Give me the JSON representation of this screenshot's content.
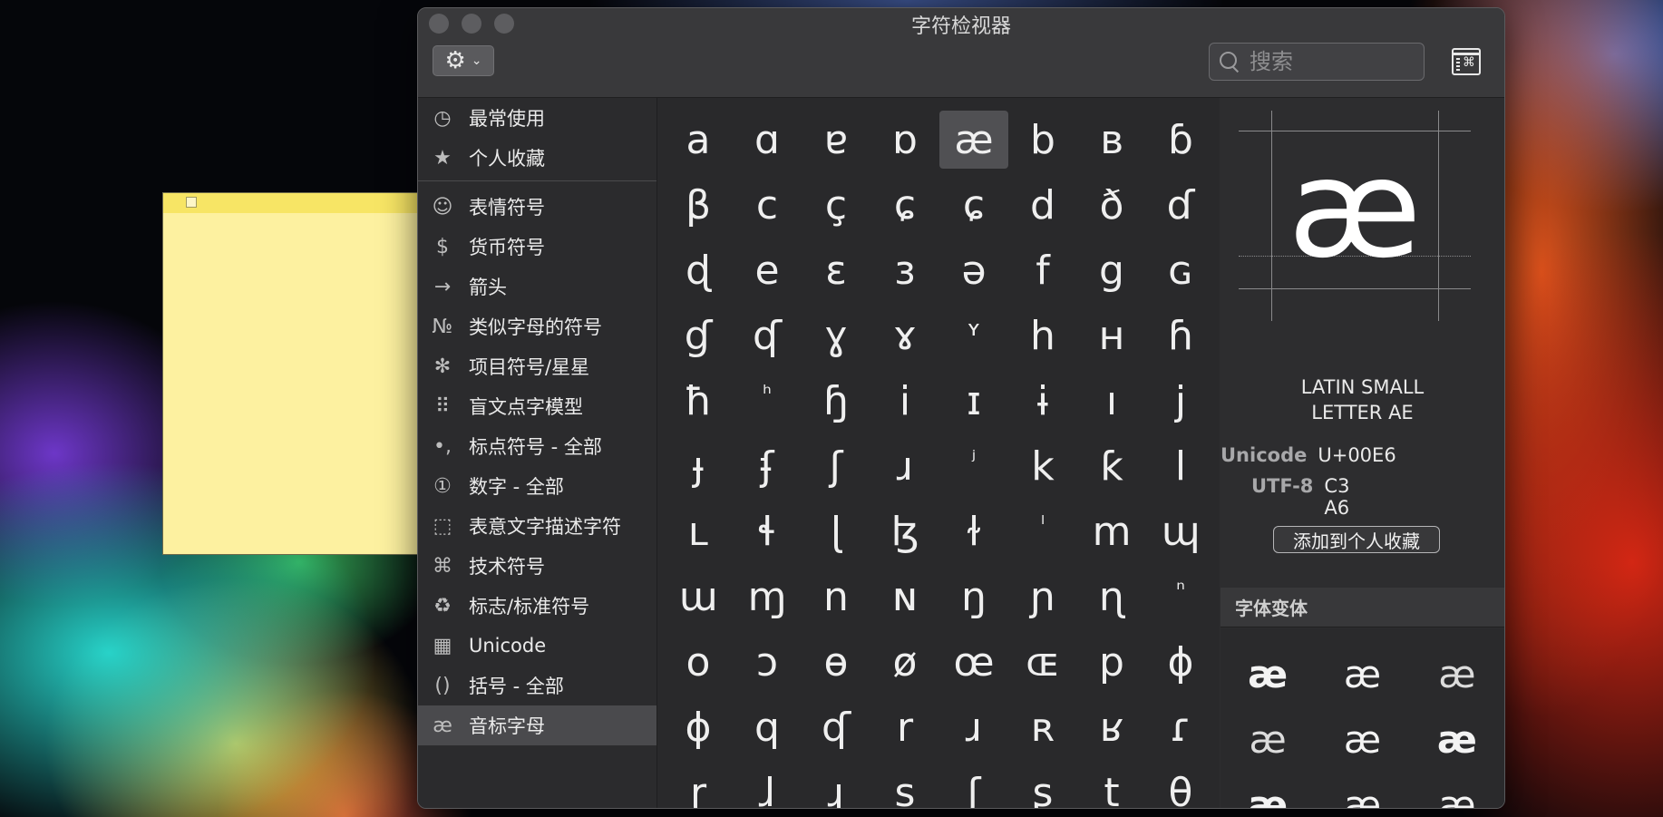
{
  "window": {
    "title": "字符检视器"
  },
  "toolbar": {
    "search_placeholder": "搜索"
  },
  "sidebar": {
    "items": [
      {
        "icon": "◷",
        "label": "最常使用"
      },
      {
        "icon": "★",
        "label": "个人收藏"
      },
      {
        "icon": "☺",
        "label": "表情符号"
      },
      {
        "icon": "$",
        "label": "货币符号"
      },
      {
        "icon": "→",
        "label": "箭头"
      },
      {
        "icon": "№",
        "label": "类似字母的符号"
      },
      {
        "icon": "✻",
        "label": "项目符号/星星"
      },
      {
        "icon": "⠿",
        "label": "盲文点字模型"
      },
      {
        "icon": "•,",
        "label": "标点符号 - 全部"
      },
      {
        "icon": "①",
        "label": "数字 - 全部"
      },
      {
        "icon": "⬚",
        "label": "表意文字描述字符"
      },
      {
        "icon": "⌘",
        "label": "技术符号"
      },
      {
        "icon": "♻",
        "label": "标志/标准符号"
      },
      {
        "icon": "▦",
        "label": "Unicode"
      },
      {
        "icon": "()",
        "label": "括号 - 全部"
      },
      {
        "icon": "æ",
        "label": "音标字母"
      }
    ]
  },
  "grid": {
    "rows": [
      [
        "a",
        "ɑ",
        "ɐ",
        "ɒ",
        "æ",
        "b",
        "ʙ",
        "ɓ"
      ],
      [
        "β",
        "c",
        "ç",
        "ɕ",
        "ɕ",
        "d",
        "ð",
        "ɗ"
      ],
      [
        "ɖ",
        "e",
        "ɛ",
        "ɜ",
        "ə",
        "f",
        "g",
        "ɢ"
      ],
      [
        "ɠ",
        "ʠ",
        "ɣ",
        "ɤ",
        "ʏ",
        "h",
        "ʜ",
        "ɦ"
      ],
      [
        "ħ",
        "ʰ",
        "ɧ",
        "i",
        "ɪ",
        "ɨ",
        "ı",
        "j"
      ],
      [
        "ɟ",
        "ʄ",
        "ʃ",
        "ɹ",
        "ʲ",
        "k",
        "ƙ",
        "l"
      ],
      [
        "ʟ",
        "ɬ",
        "ɭ",
        "ɮ",
        "ɫ",
        "ˡ",
        "m",
        "ɰ"
      ],
      [
        "ɯ",
        "ɱ",
        "n",
        "ɴ",
        "ŋ",
        "ɲ",
        "ɳ",
        "ⁿ"
      ],
      [
        "o",
        "ɔ",
        "ɵ",
        "ø",
        "œ",
        "ɶ",
        "p",
        "ɸ"
      ],
      [
        "ɸ",
        "q",
        "ʠ",
        "r",
        "ɹ",
        "ʀ",
        "ʁ",
        "ɾ"
      ],
      [
        "ɽ",
        "ɺ",
        "ɻ",
        "s",
        "ʃ",
        "ʂ",
        "t",
        "θ"
      ]
    ],
    "selected_row": 0,
    "selected_col": 4
  },
  "detail": {
    "glyph": "æ",
    "name_line1": "LATIN SMALL",
    "name_line2": "LETTER AE",
    "unicode_label": "Unicode",
    "unicode_value": "U+00E6",
    "utf8_label": "UTF-8",
    "utf8_value": "C3 A6",
    "favorite_button": "添加到个人收藏",
    "variants_header": "字体变体",
    "variants": [
      "æ",
      "æ",
      "æ",
      "æ",
      "æ",
      "æ",
      "æ",
      "æ",
      "æ"
    ]
  }
}
